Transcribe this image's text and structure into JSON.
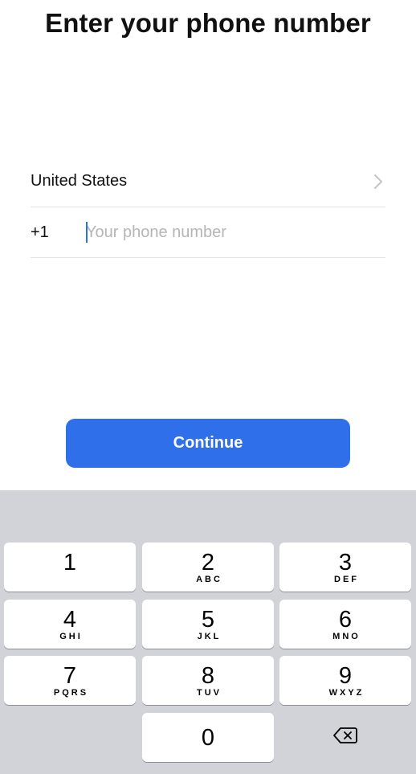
{
  "page": {
    "title": "Enter your phone number"
  },
  "country": {
    "label": "United States",
    "chevron_icon": "chevron-right-icon"
  },
  "phone": {
    "dial_code": "+1",
    "value": "",
    "placeholder": "Your phone number"
  },
  "continue_button": {
    "label": "Continue"
  },
  "colors": {
    "accent": "#2f6fea",
    "keyboard_bg": "#d2d3d8",
    "placeholder": "#b5b5ba",
    "divider": "#e4e4e6"
  },
  "keypad": {
    "keys": [
      {
        "digit": "1",
        "letters": ""
      },
      {
        "digit": "2",
        "letters": "ABC"
      },
      {
        "digit": "3",
        "letters": "DEF"
      },
      {
        "digit": "4",
        "letters": "GHI"
      },
      {
        "digit": "5",
        "letters": "JKL"
      },
      {
        "digit": "6",
        "letters": "MNO"
      },
      {
        "digit": "7",
        "letters": "PQRS"
      },
      {
        "digit": "8",
        "letters": "TUV"
      },
      {
        "digit": "9",
        "letters": "WXYZ"
      },
      {
        "digit": "0",
        "letters": ""
      }
    ],
    "delete_icon": "backspace-icon"
  }
}
